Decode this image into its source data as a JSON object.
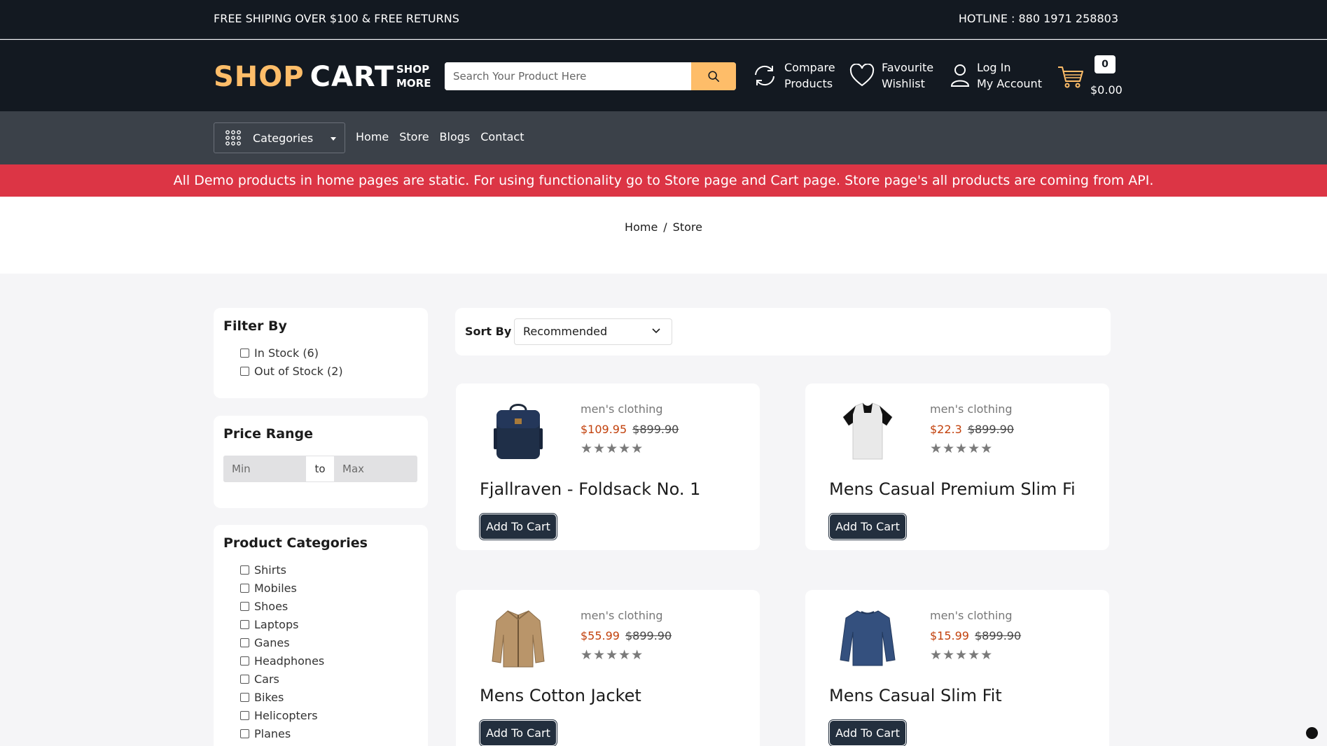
{
  "topbar": {
    "left_text": "FREE SHIPING OVER $100 & FREE RETURNS",
    "hotline": "HOTLINE : 880 1971 258803"
  },
  "header": {
    "logo_part1": "SHOP",
    "logo_part2": "CART",
    "shop_more_line1": "SHOP",
    "shop_more_line2": "MORE",
    "search_placeholder": "Search Your Product Here",
    "compare_line1": "Compare",
    "compare_line2": "Products",
    "wishlist_line1": "Favourite",
    "wishlist_line2": "Wishlist",
    "account_line1": "Log In",
    "account_line2": "My Account",
    "cart_count": "0",
    "cart_total": "$0.00",
    "accent_color": "#febd69"
  },
  "nav": {
    "categories_label": "Categories",
    "links": [
      "Home",
      "Store",
      "Blogs",
      "Contact"
    ]
  },
  "alert": {
    "text": "All Demo products in home pages are static. For using functionality go to Store page and Cart page. Store page's all products are coming from API.",
    "color": "#dc3545"
  },
  "breadcrumb": {
    "home": "Home",
    "separator": "/",
    "current": "Store"
  },
  "filters": {
    "title": "Filter By",
    "options": [
      "In Stock (6)",
      "Out of Stock (2)"
    ]
  },
  "price_range": {
    "title": "Price Range",
    "min_placeholder": "Min",
    "to_label": "to",
    "max_placeholder": "Max"
  },
  "categories": {
    "title": "Product Categories",
    "items": [
      "Shirts",
      "Mobiles",
      "Shoes",
      "Laptops",
      "Ganes",
      "Headphones",
      "Cars",
      "Bikes",
      "Helicopters",
      "Planes"
    ]
  },
  "sort": {
    "label": "Sort By",
    "selected": "Recommended"
  },
  "products": [
    {
      "brand": "men's clothing",
      "price": "$109.95",
      "old_price": "$899.90",
      "stars": "★★★★★",
      "title": "Fjallraven - Foldsack No. 1",
      "button": "Add To Cart",
      "icon": "backpack-icon"
    },
    {
      "brand": "men's clothing",
      "price": "$22.3",
      "old_price": "$899.90",
      "stars": "★★★★★",
      "title": "Mens Casual Premium Slim Fi",
      "button": "Add To Cart",
      "icon": "tshirt-icon"
    },
    {
      "brand": "men's clothing",
      "price": "$55.99",
      "old_price": "$899.90",
      "stars": "★★★★★",
      "title": "Mens Cotton Jacket",
      "button": "Add To Cart",
      "icon": "jacket-icon"
    },
    {
      "brand": "men's clothing",
      "price": "$15.99",
      "old_price": "$899.90",
      "stars": "★★★★★",
      "title": "Mens Casual Slim Fit",
      "button": "Add To Cart",
      "icon": "longsleeve-icon"
    }
  ]
}
